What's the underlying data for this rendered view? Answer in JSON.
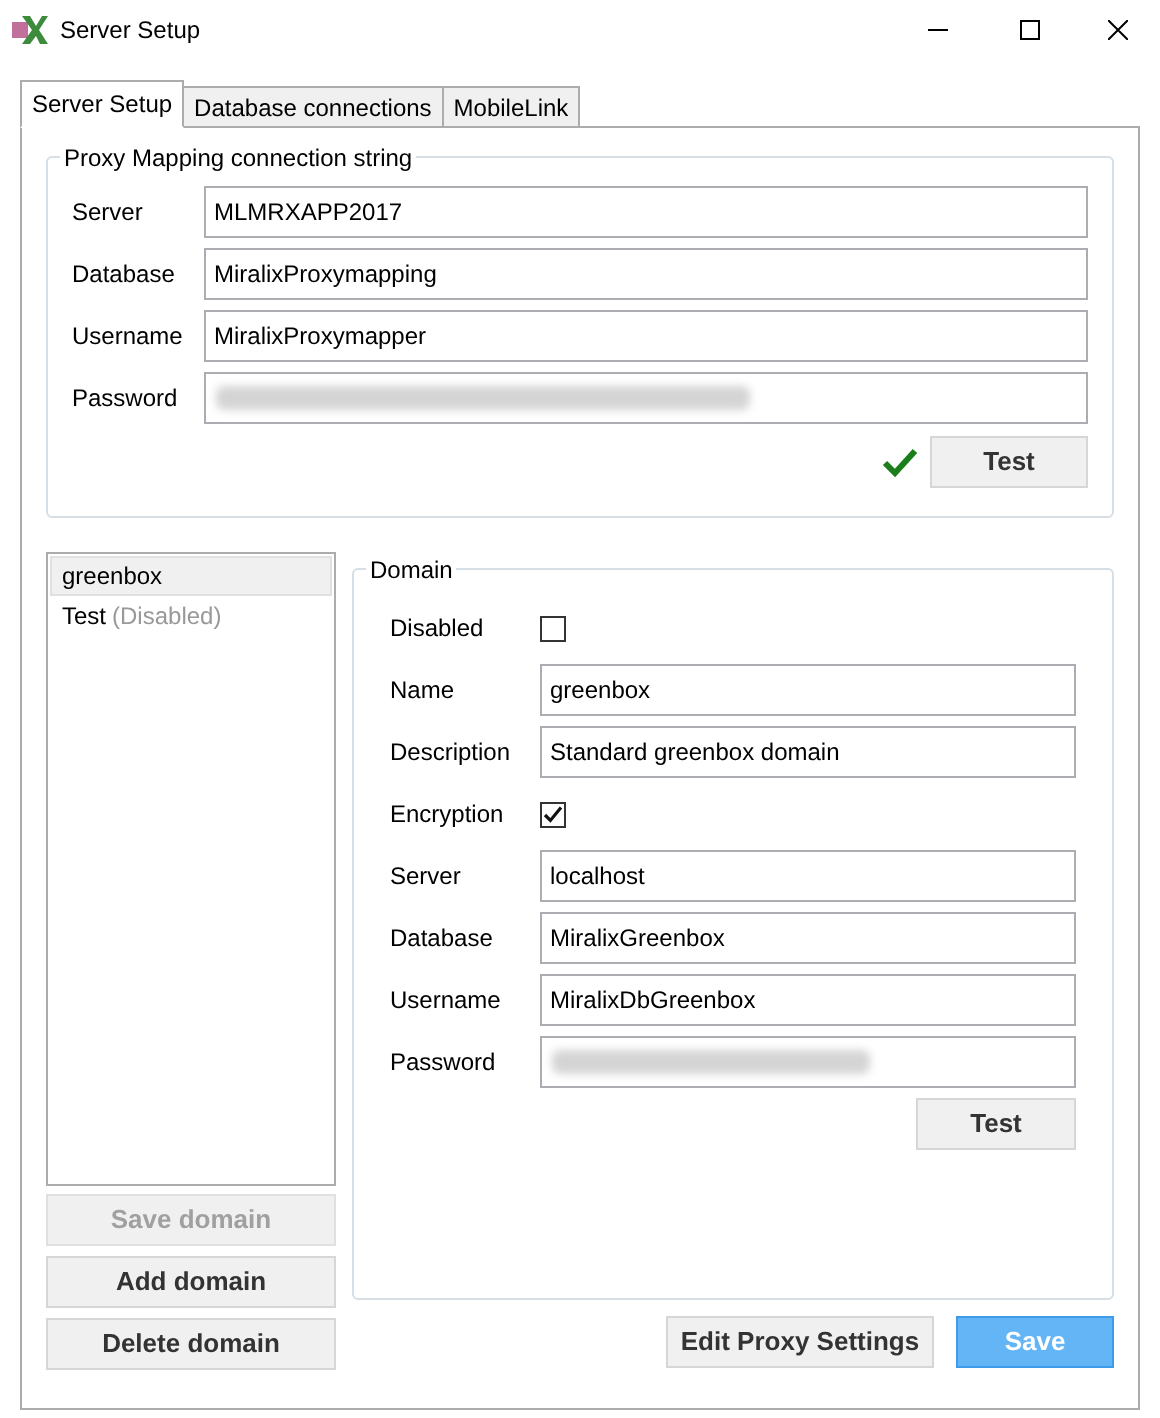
{
  "window": {
    "title": "Server Setup"
  },
  "tabs": [
    {
      "label": "Server Setup",
      "selected": true
    },
    {
      "label": "Database connections",
      "selected": false
    },
    {
      "label": "MobileLink",
      "selected": false
    }
  ],
  "proxy_group": {
    "title": "Proxy Mapping connection string",
    "fields": [
      {
        "label": "Server",
        "kind": "text",
        "value": "MLMRXAPP2017"
      },
      {
        "label": "Database",
        "kind": "text",
        "value": "MiralixProxymapping"
      },
      {
        "label": "Username",
        "kind": "text",
        "value": "MiralixProxymapper"
      },
      {
        "label": "Password",
        "kind": "password"
      }
    ],
    "test_ok": true,
    "test_button": "Test"
  },
  "domains": [
    {
      "name": "greenbox",
      "selected": true
    },
    {
      "name": "Test",
      "note": "(Disabled)",
      "selected": false
    }
  ],
  "domain_buttons": [
    {
      "label": "Save domain",
      "disabled": true
    },
    {
      "label": "Add domain",
      "disabled": false
    },
    {
      "label": "Delete domain",
      "disabled": false
    }
  ],
  "domain_group": {
    "title": "Domain",
    "fields": [
      {
        "label": "Disabled",
        "kind": "checkbox",
        "checked": false
      },
      {
        "label": "Name",
        "kind": "text",
        "value": "greenbox"
      },
      {
        "label": "Description",
        "kind": "text",
        "value": "Standard greenbox domain"
      },
      {
        "label": "Encryption",
        "kind": "checkbox",
        "checked": true
      },
      {
        "label": "Server",
        "kind": "text",
        "value": "localhost"
      },
      {
        "label": "Database",
        "kind": "text",
        "value": "MiralixGreenbox"
      },
      {
        "label": "Username",
        "kind": "text",
        "value": "MiralixDbGreenbox"
      },
      {
        "label": "Password",
        "kind": "password"
      }
    ],
    "test_button": "Test"
  },
  "footer_buttons": [
    {
      "label": "Edit Proxy Settings",
      "primary": false
    },
    {
      "label": "Save",
      "primary": true
    }
  ]
}
